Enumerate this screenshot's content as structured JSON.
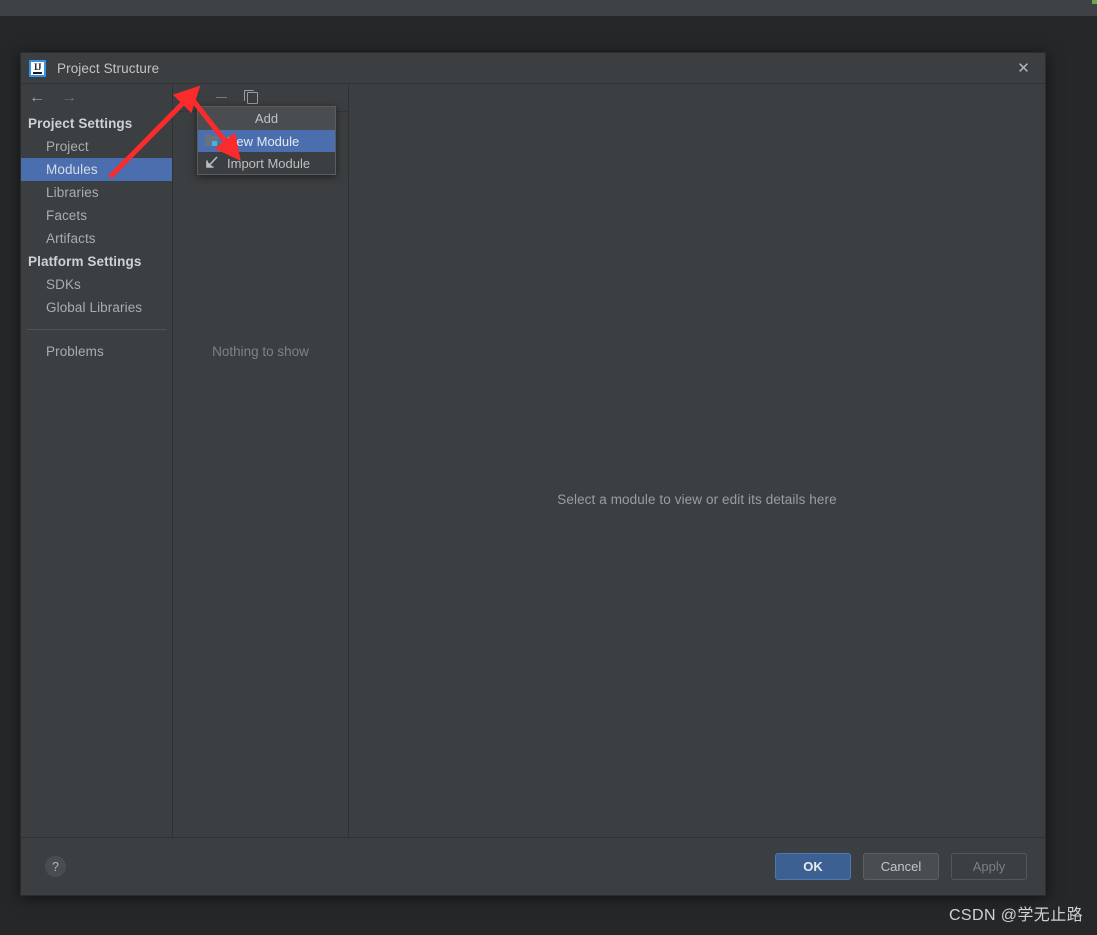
{
  "window": {
    "title": "Project Structure",
    "logo_icon": "intellij-idea-icon",
    "close_icon": "close-icon"
  },
  "navigation": {
    "back_icon": "arrow-left-icon",
    "forward_icon": "arrow-right-icon"
  },
  "sidebar": {
    "groups": [
      {
        "label": "Project Settings",
        "items": [
          {
            "label": "Project",
            "selected": false
          },
          {
            "label": "Modules",
            "selected": true
          },
          {
            "label": "Libraries",
            "selected": false
          },
          {
            "label": "Facets",
            "selected": false
          },
          {
            "label": "Artifacts",
            "selected": false
          }
        ]
      },
      {
        "label": "Platform Settings",
        "items": [
          {
            "label": "SDKs",
            "selected": false
          },
          {
            "label": "Global Libraries",
            "selected": false
          }
        ]
      }
    ],
    "extra": [
      {
        "label": "Problems",
        "selected": false
      }
    ]
  },
  "module_panel": {
    "toolbar": {
      "add_icon": "plus-icon",
      "remove_icon": "minus-icon",
      "copy_icon": "copy-icon"
    },
    "empty_text": "Nothing to show"
  },
  "details_panel": {
    "hint": "Select a module to view or edit its details here"
  },
  "add_menu": {
    "header": "Add",
    "items": [
      {
        "label": "New Module",
        "icon": "new-module-folder-icon",
        "highlighted": true
      },
      {
        "label": "Import Module",
        "icon": "import-module-icon",
        "highlighted": false
      }
    ]
  },
  "footer": {
    "help_label": "?",
    "buttons": [
      {
        "label": "OK",
        "style": "primary"
      },
      {
        "label": "Cancel",
        "style": "normal"
      },
      {
        "label": "Apply",
        "style": "disabled"
      }
    ]
  },
  "watermark": {
    "text": "CSDN @学无止路"
  },
  "colors": {
    "dialog_bg": "#3c3f41",
    "selection_blue": "#4b6eaf",
    "primary_button": "#3c6092",
    "annotation_red": "#fb2b2b",
    "accent_cyan": "#40b6e0"
  }
}
